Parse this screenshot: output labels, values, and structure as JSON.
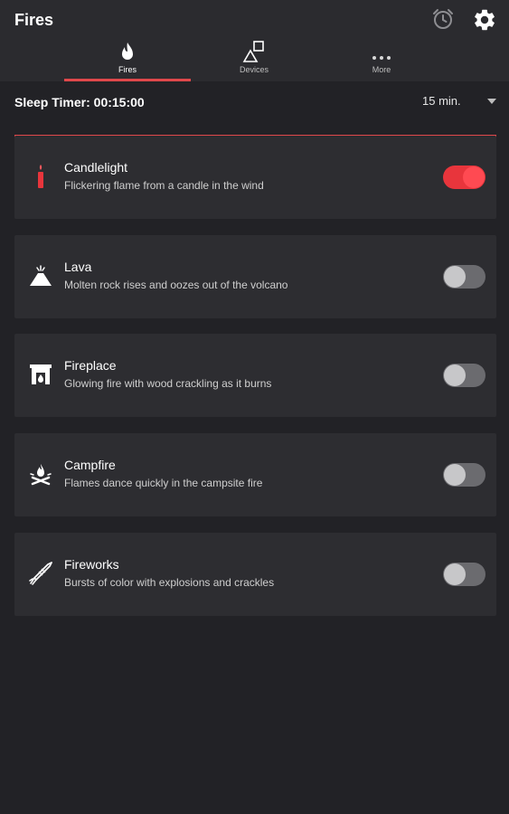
{
  "app": {
    "title": "Fires"
  },
  "header_icons": {
    "alarm": "alarm-clock-icon",
    "settings": "gear-icon"
  },
  "tabs": [
    {
      "label": "Fires",
      "icon": "flame-icon",
      "active": true
    },
    {
      "label": "Devices",
      "icon": "devices-icon",
      "active": false
    },
    {
      "label": "More",
      "icon": "more-dots-icon",
      "active": false
    }
  ],
  "sleep_timer": {
    "label": "Sleep Timer: 00:15:00",
    "selected_duration": "15 min.",
    "progress_fraction": 1.0
  },
  "fires": [
    {
      "title": "Candlelight",
      "description": "Flickering flame from a candle in the wind",
      "icon": "candle-icon",
      "enabled": true
    },
    {
      "title": "Lava",
      "description": "Molten rock rises and oozes out of the volcano",
      "icon": "volcano-icon",
      "enabled": false
    },
    {
      "title": "Fireplace",
      "description": "Glowing fire with wood crackling as it burns",
      "icon": "fireplace-icon",
      "enabled": false
    },
    {
      "title": "Campfire",
      "description": "Flames dance quickly in the campsite fire",
      "icon": "campfire-icon",
      "enabled": false
    },
    {
      "title": "Fireworks",
      "description": "Bursts of color with explosions and crackles",
      "icon": "firework-rocket-icon",
      "enabled": false
    }
  ],
  "colors": {
    "accent": "#e0484b",
    "background": "#222226",
    "card": "#2d2d31",
    "toggle_on": "#e8353c",
    "toggle_off": "#6b6b6f"
  }
}
